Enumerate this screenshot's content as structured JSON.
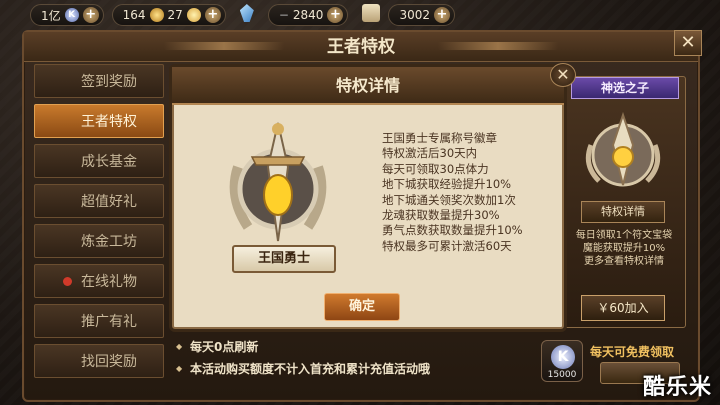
{
  "topbar": {
    "currency_k": "1亿",
    "gold": "164",
    "coupons": "27",
    "crystals": "2840",
    "scrolls": "3002"
  },
  "panel": {
    "title": "王者特权",
    "close": "✕"
  },
  "sidebar": {
    "items": [
      {
        "label": "签到奖励"
      },
      {
        "label": "王者特权"
      },
      {
        "label": "成长基金"
      },
      {
        "label": "超值好礼"
      },
      {
        "label": "炼金工坊"
      },
      {
        "label": "在线礼物"
      },
      {
        "label": "推广有礼"
      },
      {
        "label": "找回奖励"
      }
    ],
    "active_index": 1
  },
  "dialog": {
    "title": "特权详情",
    "close": "✕",
    "badge_name": "王国勇士",
    "perks": [
      "王国勇士专属称号徽章",
      "特权激活后30天内",
      "每天可领取30点体力",
      "地下城获取经验提升10%",
      "地下城通关领奖次数加1次",
      "龙魂获取数量提升30%",
      "勇气点数获取数量提升10%",
      "特权最多可累计激活60天"
    ],
    "confirm": "确定"
  },
  "card": {
    "title": "神选之子",
    "detail_button": "特权详情",
    "lines": [
      "每日领取1个符文宝袋",
      "魔能获取提升10%",
      "更多查看特权详情"
    ],
    "buy_button": "￥60加入"
  },
  "footer": {
    "notes": [
      "每天0点刷新",
      "本活动购买额度不计入首充和累计充值活动哦"
    ],
    "token_amount": "15000",
    "free_text": "每天可免费领取"
  },
  "watermark": "酷乐米",
  "colors": {
    "accent_orange": "#c97a2c",
    "parchment": "#e9dcc2",
    "purple_header": "#6a4aa8"
  }
}
